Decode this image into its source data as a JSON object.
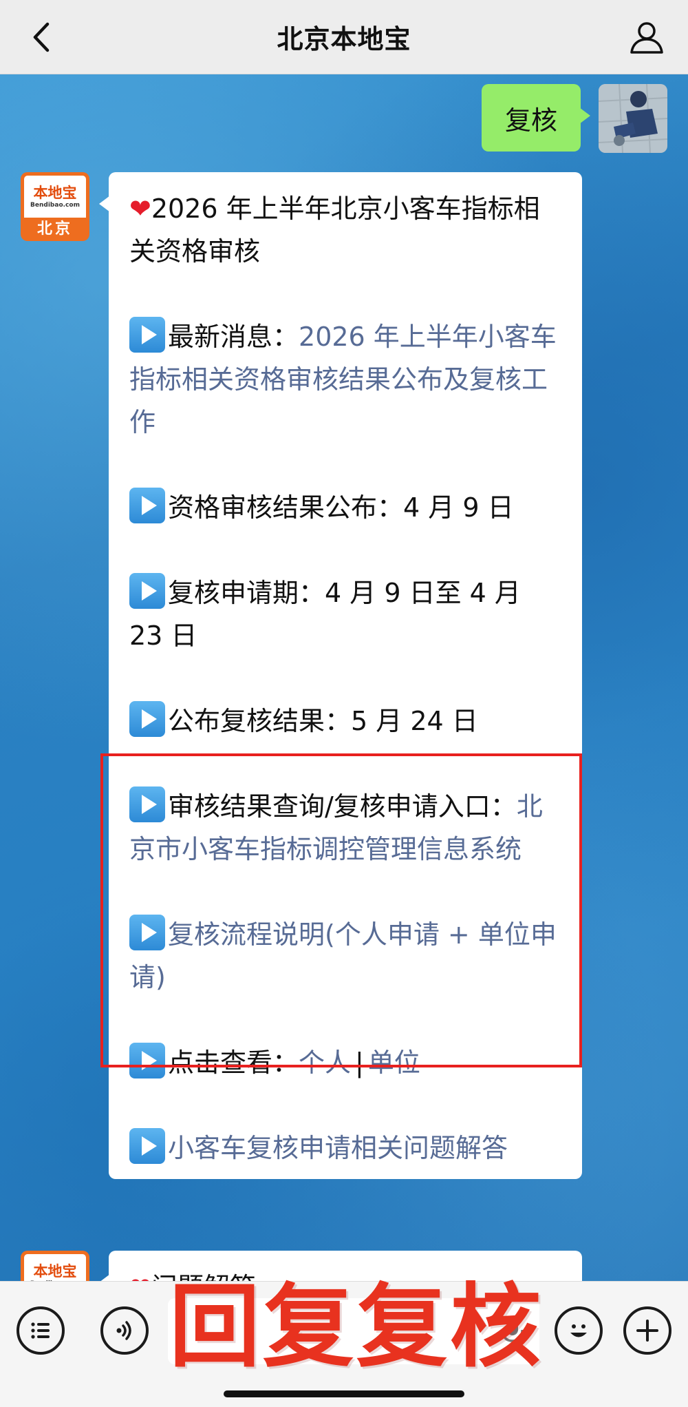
{
  "header": {
    "title": "北京本地宝"
  },
  "user_message": {
    "text": "复核"
  },
  "bot_avatar": {
    "brand": "本地宝",
    "url": "Bendibao.com",
    "city": "北京"
  },
  "bot_message": {
    "heading": "2026 年上半年北京小客车指标相关资格审核",
    "news_label": "最新消息：",
    "news_link": "2026 年上半年小客车指标相关资格审核结果公布及复核工作",
    "result_publish": "资格审核结果公布：4 月 9 日",
    "review_period": "复核申请期：4 月 9 日至 4 月 23 日",
    "review_result": "公布复核结果：5 月 24 日",
    "entry_label": "审核结果查询/复核申请入口：",
    "entry_link": "北京市小客车指标调控管理信息系统",
    "process_link": "复核流程说明(个人申请 + 单位申请)",
    "view_label": "点击查看：",
    "view_personal": "个人",
    "view_sep": "|",
    "view_unit": "单位",
    "faq_link": "小客车复核申请相关问题解答"
  },
  "next_message": {
    "heading": "问题解答"
  },
  "overlay": {
    "text": "回复复核"
  },
  "colors": {
    "link": "#576b95",
    "user_bubble": "#95ec69",
    "highlight": "#e8211f"
  }
}
